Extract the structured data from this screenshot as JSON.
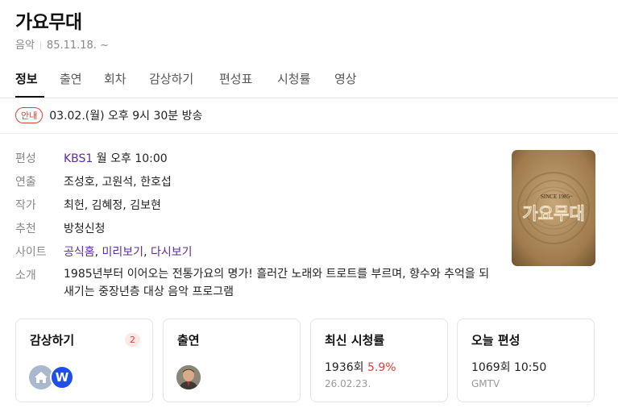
{
  "header": {
    "title": "가요무대",
    "genre": "음악",
    "start_date": "85.11.18. ~"
  },
  "tabs": [
    {
      "label": "정보",
      "active": true
    },
    {
      "label": "출연"
    },
    {
      "label": "회차"
    },
    {
      "label": "감상하기"
    },
    {
      "label": "편성표"
    },
    {
      "label": "시청률"
    },
    {
      "label": "영상"
    }
  ],
  "notice": {
    "badge": "안내",
    "text": "03.02.(월) 오후 9시 30분 방송"
  },
  "info": {
    "schedule": {
      "key": "편성",
      "channel": "KBS1",
      "time": " 월 오후 10:00"
    },
    "director": {
      "key": "연출",
      "value": "조성호, 고원석, 한호섭"
    },
    "writer": {
      "key": "작가",
      "value": "최헌, 김혜정, 김보현"
    },
    "recommend": {
      "key": "추천",
      "value": "방청신청"
    },
    "site": {
      "key": "사이트",
      "links": [
        "공식홈",
        "미리보기",
        "다시보기"
      ],
      "separator": ", "
    },
    "intro": {
      "key": "소개",
      "value": "1985년부터 이어오는 전통가요의 명가! 흘러간 노래와 트로트를 부르며, 향수와 추억을 되새기는 중장년층 대상 음악 프로그램"
    }
  },
  "poster": {
    "since": "SINCE 1985~",
    "logo": "가요무대"
  },
  "cards": {
    "watch": {
      "title": "감상하기",
      "count": "2",
      "icons": [
        "home-icon",
        "wavve-icon"
      ],
      "wavve_letter": "W"
    },
    "cast": {
      "title": "출연"
    },
    "rating": {
      "title": "최신 시청률",
      "episode": "1936회",
      "value": "5.9%",
      "date": "26.02.23."
    },
    "today": {
      "title": "오늘 편성",
      "episode_time": "1069회 10:50",
      "channel": "GMTV"
    }
  },
  "colors": {
    "accent_red": "#e0403a",
    "link_purple": "#5b2d9e",
    "link_blue": "#2a5bbf",
    "wavve_blue": "#1f4ee8"
  }
}
